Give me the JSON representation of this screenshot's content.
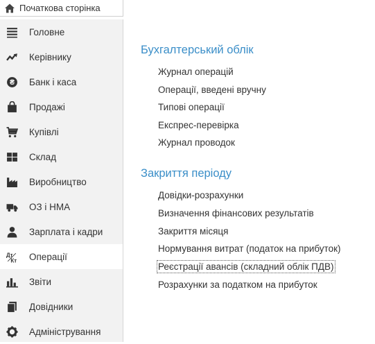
{
  "header": {
    "home_label": "Початкова сторінка"
  },
  "sidebar": {
    "items": [
      {
        "label": "Головне",
        "icon": "list-icon"
      },
      {
        "label": "Керівнику",
        "icon": "trend-icon"
      },
      {
        "label": "Банк і каса",
        "icon": "coin-icon"
      },
      {
        "label": "Продажі",
        "icon": "bag-icon"
      },
      {
        "label": "Купівлі",
        "icon": "cart-icon"
      },
      {
        "label": "Склад",
        "icon": "warehouse-icon"
      },
      {
        "label": "Виробництво",
        "icon": "factory-icon"
      },
      {
        "label": "ОЗ і НМА",
        "icon": "truck-icon"
      },
      {
        "label": "Зарплата і кадри",
        "icon": "person-icon"
      },
      {
        "label": "Операції",
        "icon": "dt-kt-icon"
      },
      {
        "label": "Звіти",
        "icon": "bar-chart-icon"
      },
      {
        "label": "Довідники",
        "icon": "books-icon"
      },
      {
        "label": "Адміністрування",
        "icon": "gear-icon"
      }
    ],
    "active_index": 9
  },
  "main": {
    "sections": [
      {
        "title": "Бухгалтерський облік",
        "links": [
          "Журнал операцій",
          "Операції, введені вручну",
          "Типові операції",
          "Експрес-перевірка",
          "Журнал проводок"
        ]
      },
      {
        "title": "Закриття періоду",
        "links": [
          "Довідки-розрахунки",
          "Визначення фінансових результатів",
          "Закриття місяця",
          "Нормування витрат (податок на прибуток)",
          "Реєстрації авансів (складний облік ПДВ)",
          "Розрахунки за податком на прибуток"
        ]
      }
    ]
  },
  "colors": {
    "accent": "#3a8ec8",
    "sidebar_bg": "#f2f2f2",
    "text": "#333333"
  }
}
